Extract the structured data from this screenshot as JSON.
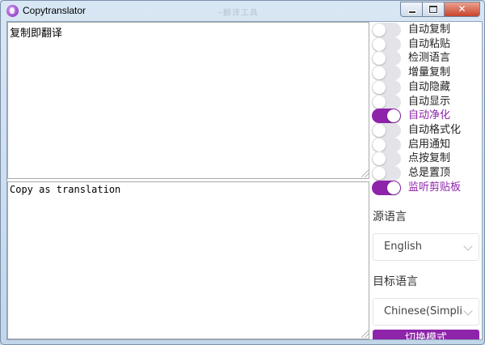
{
  "window": {
    "title": "Copytranslator",
    "faded_title": "~翻译工具"
  },
  "source_text": "复制即翻译",
  "target_text": "Copy as translation",
  "toggles": [
    {
      "label": "自动复制",
      "on": false
    },
    {
      "label": "自动粘贴",
      "on": false
    },
    {
      "label": "检测语言",
      "on": false
    },
    {
      "label": "增量复制",
      "on": false
    },
    {
      "label": "自动隐藏",
      "on": false
    },
    {
      "label": "自动显示",
      "on": false
    },
    {
      "label": "自动净化",
      "on": true
    },
    {
      "label": "自动格式化",
      "on": false
    },
    {
      "label": "启用通知",
      "on": false
    },
    {
      "label": "点按复制",
      "on": false
    },
    {
      "label": "总是置顶",
      "on": false
    },
    {
      "label": "监听剪贴板",
      "on": true
    }
  ],
  "source_language": {
    "label": "源语言",
    "value": "English"
  },
  "target_language": {
    "label": "目标语言",
    "value": "Chinese(Simplified)"
  },
  "mode_button": {
    "label": "切换模式"
  },
  "colors": {
    "accent": "#8e24aa",
    "switch_off": "#e3e3e8"
  }
}
